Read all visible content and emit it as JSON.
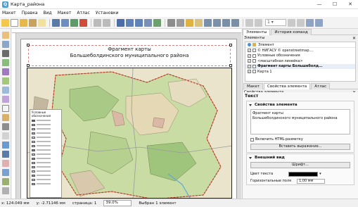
{
  "window": {
    "title": "Карта_района",
    "minimize": "—",
    "maximize": "☐",
    "close": "✕"
  },
  "menu": [
    "Макет",
    "Правка",
    "Вид",
    "Макет",
    "Атлас",
    "Установки"
  ],
  "toolbar": {
    "page_value": "1",
    "page_arrow": "▾"
  },
  "map": {
    "title_line1": "Фрагмент карты",
    "title_line2": "Большеболдинского муниципального района",
    "legend_title": "Условные обозначения",
    "colors": {
      "forest": "#b9d49a",
      "field": "#efe7c6",
      "settlement": "#d9c7b1",
      "border": "#c0392b",
      "water": "#9cc7e8"
    }
  },
  "panels": {
    "tabs": [
      "Элементы",
      "История команд"
    ],
    "elements_title": "Элементы",
    "elements_header": "Элемент",
    "items": [
      {
        "label": "© НИГАСУ © openstreetmap....",
        "checked": true,
        "bold": false
      },
      {
        "label": "Условные обозначения",
        "checked": true,
        "bold": false
      },
      {
        "label": "<масштабная линейка>",
        "checked": true,
        "bold": false
      },
      {
        "label": "Фрагмент карты Большеболд...",
        "checked": true,
        "bold": true
      },
      {
        "label": "Карта 1",
        "checked": true,
        "bold": false
      }
    ],
    "subtabs": [
      "Макет",
      "Свойства элемента",
      "Атлас"
    ],
    "props_title": "Свойства элемента",
    "text_label": "Текст",
    "main_props_label": "Свойства элемента",
    "text_value_line1": "Фрагмент карты",
    "text_value_line2": "Большеболдинского муниципального района",
    "html_checkbox": "Включить HTML-разметку",
    "insert_expression": "Вставить выражение...",
    "appearance_label": "Внешний вид",
    "font_button": "Шрифт...",
    "text_color_label": "Цвет текста",
    "hmargin_label": "Горизонтальные поля",
    "hmargin_value": "1,00 мм"
  },
  "status": {
    "x": "x: 124.049 мм",
    "y": "y: -2.71146 мм",
    "page": "страница: 1",
    "zoom": "39.0%",
    "selection": "Выбран 1 элемент"
  }
}
